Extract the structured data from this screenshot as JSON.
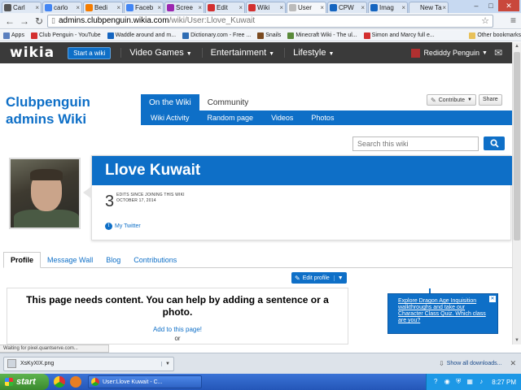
{
  "browser": {
    "tabs": [
      {
        "label": "Carl",
        "color": "#555555"
      },
      {
        "label": "carlo",
        "color": "#4285f4"
      },
      {
        "label": "Bedi",
        "color": "#f57c00"
      },
      {
        "label": "Faceb",
        "color": "#4285f4"
      },
      {
        "label": "Scree",
        "color": "#9c27b0"
      },
      {
        "label": "Edit",
        "color": "#d32f2f"
      },
      {
        "label": "Wiki",
        "color": "#d32f2f"
      },
      {
        "label": "User",
        "color": "#bbbbbb"
      },
      {
        "label": "CPW",
        "color": "#1565c0"
      },
      {
        "label": "Imag",
        "color": "#1565c0"
      },
      {
        "label": "New Tab",
        "color": "#dfe8f4"
      }
    ],
    "url_host": "admins.clubpenguin.wikia.com",
    "url_path": "/wiki/User:Llove_Kuwait",
    "bookmarks": [
      {
        "label": "Apps",
        "color": "#5a7fbf"
      },
      {
        "label": "Club Penguin - YouTube",
        "color": "#d32f2f"
      },
      {
        "label": "Waddle around and m...",
        "color": "#1565c0"
      },
      {
        "label": "Dictionary.com - Free ...",
        "color": "#2e6db4"
      },
      {
        "label": "Snails",
        "color": "#7a4a20"
      },
      {
        "label": "Minecraft Wiki - The ul...",
        "color": "#5a8a3a"
      },
      {
        "label": "Simon and Marcy full e...",
        "color": "#d32f2f"
      }
    ],
    "other_bookmarks": "Other bookmarks"
  },
  "wikia_nav": {
    "logo": "wikia",
    "start_wiki": "Start a wiki",
    "hubs": [
      "Video Games",
      "Entertainment",
      "Lifestyle"
    ],
    "username": "Rediddy Penguin"
  },
  "wiki": {
    "name": "Clubpenguin admins Wiki",
    "tabs": [
      "On the Wiki",
      "Community"
    ],
    "subnav": [
      "Wiki Activity",
      "Random page",
      "Videos",
      "Photos"
    ],
    "contribute": "Contribute",
    "share": "Share",
    "search_placeholder": "Search this wiki"
  },
  "profile": {
    "username": "Llove Kuwait",
    "edit_count": "3",
    "edit_label": "Edits since joining this wiki",
    "joined_date": "October 17, 2014",
    "twitter": "My Twitter",
    "tabs": [
      "Profile",
      "Message Wall",
      "Blog",
      "Contributions"
    ],
    "edit_profile": "Edit profile",
    "empty_message": "This page needs content. You can help by adding a sentence or a photo.",
    "add_link": "Add to this page!",
    "or_text": "or"
  },
  "ad": {
    "text": "Explore Dragon Age Inquisition walkthroughs and take our Character Class Quiz. Which class are you?"
  },
  "status": {
    "text": "Waiting for pixel.quantserve.com..."
  },
  "downloads": {
    "file": "XsKyXIX.png",
    "show_all": "Show all downloads..."
  },
  "taskbar": {
    "start": "start",
    "window": "User:Llove Kuwait - C...",
    "time": "8:27 PM"
  }
}
